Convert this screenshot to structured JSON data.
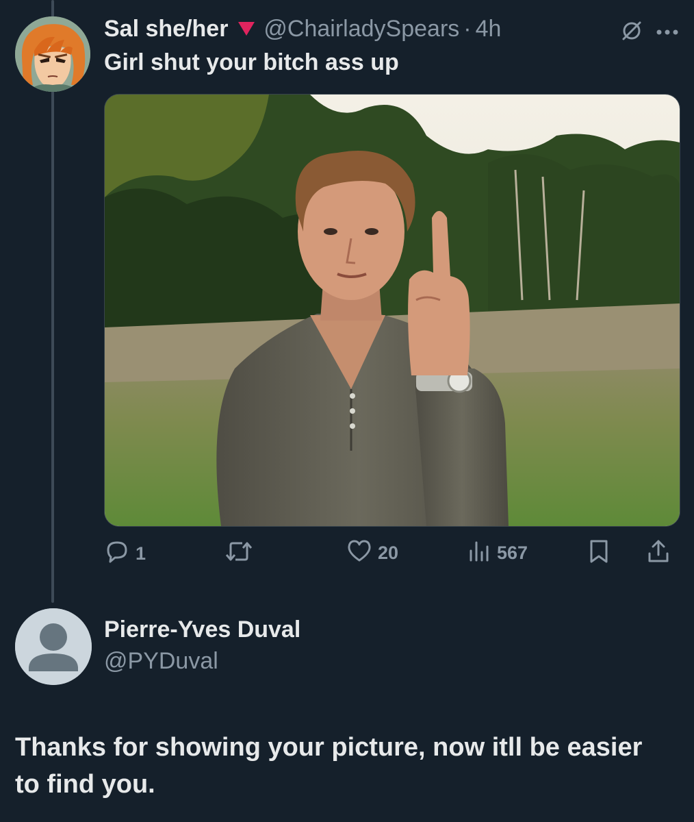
{
  "tweet": {
    "display_name": "Sal she/her",
    "handle": "@ChairladySpears",
    "separator": "·",
    "time": "4h",
    "text": "Girl shut your bitch ass up",
    "flag_icon": "red-triangle-down-icon",
    "actions": {
      "replies": "1",
      "retweets": "",
      "likes": "20",
      "views": "567"
    }
  },
  "reply": {
    "display_name": "Pierre-Yves Duval",
    "handle": "@PYDuval",
    "text": "Thanks for showing your picture, now itll be easier to find you."
  },
  "colors": {
    "background": "#15202b",
    "text_primary": "#e7e9ea",
    "text_secondary": "#8b98a5",
    "thread_line": "#3d4a57",
    "flag_red": "#e0245e"
  }
}
